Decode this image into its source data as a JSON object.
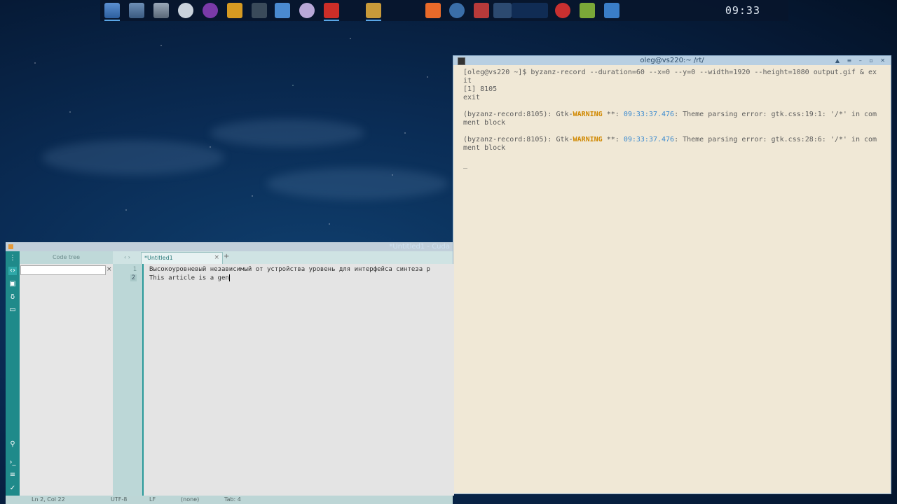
{
  "colors": {
    "terminal_bg": "#f0e8d6",
    "warning": "#d08800",
    "timestamp": "#3a8ad0",
    "accent_teal": "#1f8a8a"
  },
  "dock": {
    "clock": "09:33",
    "icons": [
      "screenshot-icon",
      "calculator-icon",
      "system-settings-icon",
      "browser-icon",
      "media-player-icon",
      "equalizer-icon",
      "terminal-icon",
      "file-manager-icon",
      "paint-icon",
      "opera-icon",
      "archive-icon",
      "printer-icon",
      "back-icon",
      "image-viewer-icon",
      "wallpaper-icon",
      "wallpaper-icon-2",
      "power-icon",
      "audio-mixer-icon",
      "window-switcher-icon"
    ]
  },
  "terminal": {
    "title": "oleg@vs220:~  /rt/",
    "lines": [
      {
        "text": "[oleg@vs220 ~]$ byzanz-record --duration=60 --x=0 --y=0 --width=1920 --height=1080 output.gif & exit"
      },
      {
        "text": "[1] 8105"
      },
      {
        "text": "exit"
      },
      {
        "text": ""
      },
      {
        "prefix": "(byzanz-record:8105): Gtk-",
        "warn": "WARNING",
        "mid": " **: ",
        "time": "09:33:37.476",
        "suffix": ": Theme parsing error: gtk.css:19:1: '/*' in comment block"
      },
      {
        "text": ""
      },
      {
        "prefix": "(byzanz-record:8105): Gtk-",
        "warn": "WARNING",
        "mid": " **: ",
        "time": "09:33:37.476",
        "suffix": ": Theme parsing error: gtk.css:28:6: '/*' in comment block"
      },
      {
        "text": ""
      },
      {
        "text": "_"
      }
    ]
  },
  "editor": {
    "title": "*Untitled1 - Cuda",
    "code_tree_label": "Code tree",
    "nav_arrows": "‹ ›",
    "tab_label": "*Untitled1",
    "tab_close": "×",
    "tab_add": "+",
    "lines": [
      {
        "num": "1",
        "text": "Высокоуровневый независимый от устройства уровень для интерфейса синтеза р"
      },
      {
        "num": "2",
        "text": "This article is a gen"
      }
    ],
    "status": {
      "position": "Ln 2, Col 22",
      "encoding": "UTF-8",
      "line_ending": "LF",
      "lexer": "(none)",
      "tab": "Tab: 4"
    }
  }
}
